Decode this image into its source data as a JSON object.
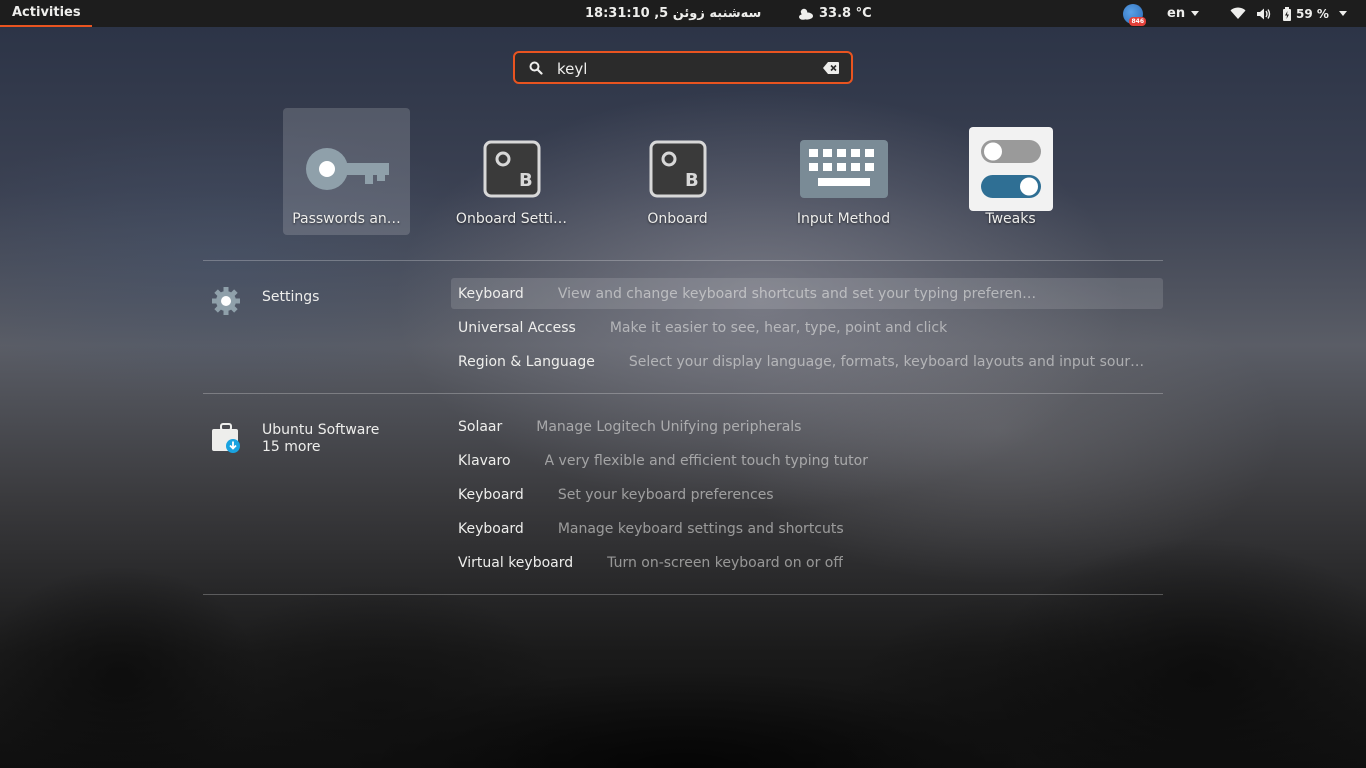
{
  "topbar": {
    "activities": "Activities",
    "clock": "18:31:10 ,5  سەشنبە زوئن",
    "weather_temp": "33.8 °C",
    "tray_badge_count": "846",
    "lang": "en",
    "battery": "59 %"
  },
  "search": {
    "value": "keyl"
  },
  "apps": [
    {
      "label": "Passwords an…",
      "icon": "key-icon"
    },
    {
      "label": "Onboard Setti…",
      "icon": "onboard-settings-icon"
    },
    {
      "label": "Onboard",
      "icon": "onboard-icon"
    },
    {
      "label": "Input Method",
      "icon": "keyboard-icon"
    },
    {
      "label": "Tweaks",
      "icon": "toggle-switches-icon"
    }
  ],
  "settings": {
    "name": "Settings",
    "results": [
      {
        "title": "Keyboard",
        "desc": "View and change keyboard shortcuts and set your typing preferen…"
      },
      {
        "title": "Universal Access",
        "desc": "Make it easier to see, hear, type, point and click"
      },
      {
        "title": "Region & Language",
        "desc": "Select your display language, formats, keyboard layouts and input sour…"
      }
    ]
  },
  "software": {
    "name": "Ubuntu Software",
    "more": "15 more",
    "results": [
      {
        "title": "Solaar",
        "desc": "Manage Logitech Unifying peripherals"
      },
      {
        "title": "Klavaro",
        "desc": "A very flexible and efficient touch typing tutor"
      },
      {
        "title": "Keyboard",
        "desc": "Set your keyboard preferences"
      },
      {
        "title": "Keyboard",
        "desc": "Manage keyboard settings and shortcuts"
      },
      {
        "title": "Virtual keyboard",
        "desc": "Turn on-screen keyboard on or off"
      }
    ]
  },
  "colors": {
    "accent": "#e95420",
    "topbar": "#1d1d1d"
  }
}
